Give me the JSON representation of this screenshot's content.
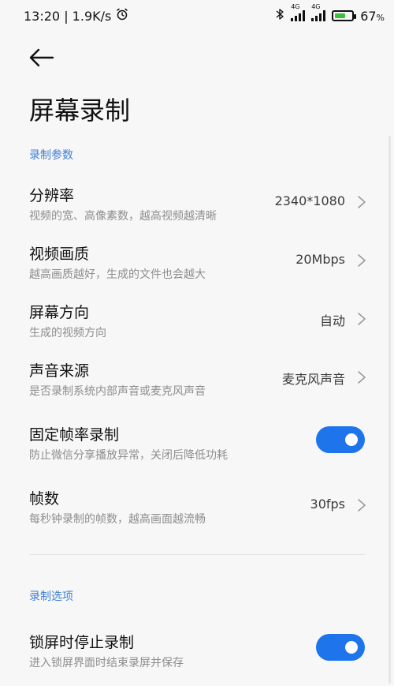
{
  "status": {
    "time_speed": "13:20 | 1.9K/s",
    "signal1_label": "4G",
    "signal2_label": "4G",
    "battery_percent": "67",
    "battery_percent_symbol": "%",
    "battery_level": 0.67
  },
  "header": {
    "title": "屏幕录制"
  },
  "sections": [
    {
      "label": "录制参数",
      "items": [
        {
          "title": "分辨率",
          "subtitle": "视频的宽、高像素数，越高视频越清晰",
          "value": "2340*1080"
        },
        {
          "title": "视频画质",
          "subtitle": "越高画质越好，生成的文件也会越大",
          "value": "20Mbps"
        },
        {
          "title": "屏幕方向",
          "subtitle": "生成的视频方向",
          "value": "自动"
        },
        {
          "title": "声音来源",
          "subtitle": "是否录制系统内部声音或麦克风声音",
          "value": "麦克风声音"
        },
        {
          "title": "固定帧率录制",
          "subtitle": "防止微信分享播放异常，关闭后降低功耗",
          "toggle": true
        },
        {
          "title": "帧数",
          "subtitle": "每秒钟录制的帧数，越高画面越流畅",
          "value": "30fps"
        }
      ]
    },
    {
      "label": "录制选项",
      "items": [
        {
          "title": "锁屏时停止录制",
          "subtitle": "进入锁屏界面时结束录屏并保存",
          "toggle": true
        }
      ]
    }
  ],
  "colors": {
    "accent": "#1e74ea",
    "section_label": "#3f7fd5",
    "background": "#f7f7f7"
  }
}
